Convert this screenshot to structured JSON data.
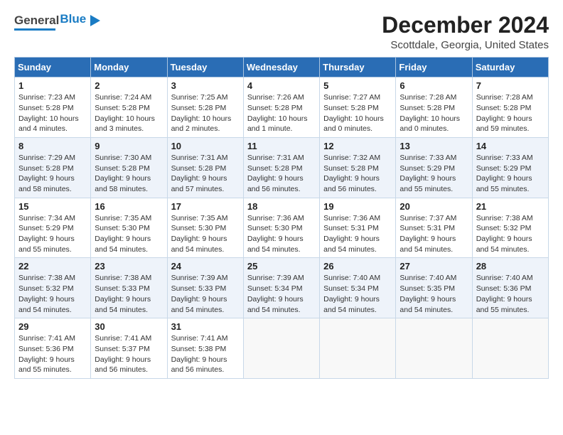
{
  "header": {
    "logo_general": "General",
    "logo_blue": "Blue",
    "month_title": "December 2024",
    "location": "Scottdale, Georgia, United States"
  },
  "weekdays": [
    "Sunday",
    "Monday",
    "Tuesday",
    "Wednesday",
    "Thursday",
    "Friday",
    "Saturday"
  ],
  "weeks": [
    [
      {
        "day": "1",
        "sunrise": "Sunrise: 7:23 AM",
        "sunset": "Sunset: 5:28 PM",
        "daylight": "Daylight: 10 hours and 4 minutes."
      },
      {
        "day": "2",
        "sunrise": "Sunrise: 7:24 AM",
        "sunset": "Sunset: 5:28 PM",
        "daylight": "Daylight: 10 hours and 3 minutes."
      },
      {
        "day": "3",
        "sunrise": "Sunrise: 7:25 AM",
        "sunset": "Sunset: 5:28 PM",
        "daylight": "Daylight: 10 hours and 2 minutes."
      },
      {
        "day": "4",
        "sunrise": "Sunrise: 7:26 AM",
        "sunset": "Sunset: 5:28 PM",
        "daylight": "Daylight: 10 hours and 1 minute."
      },
      {
        "day": "5",
        "sunrise": "Sunrise: 7:27 AM",
        "sunset": "Sunset: 5:28 PM",
        "daylight": "Daylight: 10 hours and 0 minutes."
      },
      {
        "day": "6",
        "sunrise": "Sunrise: 7:28 AM",
        "sunset": "Sunset: 5:28 PM",
        "daylight": "Daylight: 10 hours and 0 minutes."
      },
      {
        "day": "7",
        "sunrise": "Sunrise: 7:28 AM",
        "sunset": "Sunset: 5:28 PM",
        "daylight": "Daylight: 9 hours and 59 minutes."
      }
    ],
    [
      {
        "day": "8",
        "sunrise": "Sunrise: 7:29 AM",
        "sunset": "Sunset: 5:28 PM",
        "daylight": "Daylight: 9 hours and 58 minutes."
      },
      {
        "day": "9",
        "sunrise": "Sunrise: 7:30 AM",
        "sunset": "Sunset: 5:28 PM",
        "daylight": "Daylight: 9 hours and 58 minutes."
      },
      {
        "day": "10",
        "sunrise": "Sunrise: 7:31 AM",
        "sunset": "Sunset: 5:28 PM",
        "daylight": "Daylight: 9 hours and 57 minutes."
      },
      {
        "day": "11",
        "sunrise": "Sunrise: 7:31 AM",
        "sunset": "Sunset: 5:28 PM",
        "daylight": "Daylight: 9 hours and 56 minutes."
      },
      {
        "day": "12",
        "sunrise": "Sunrise: 7:32 AM",
        "sunset": "Sunset: 5:28 PM",
        "daylight": "Daylight: 9 hours and 56 minutes."
      },
      {
        "day": "13",
        "sunrise": "Sunrise: 7:33 AM",
        "sunset": "Sunset: 5:29 PM",
        "daylight": "Daylight: 9 hours and 55 minutes."
      },
      {
        "day": "14",
        "sunrise": "Sunrise: 7:33 AM",
        "sunset": "Sunset: 5:29 PM",
        "daylight": "Daylight: 9 hours and 55 minutes."
      }
    ],
    [
      {
        "day": "15",
        "sunrise": "Sunrise: 7:34 AM",
        "sunset": "Sunset: 5:29 PM",
        "daylight": "Daylight: 9 hours and 55 minutes."
      },
      {
        "day": "16",
        "sunrise": "Sunrise: 7:35 AM",
        "sunset": "Sunset: 5:30 PM",
        "daylight": "Daylight: 9 hours and 54 minutes."
      },
      {
        "day": "17",
        "sunrise": "Sunrise: 7:35 AM",
        "sunset": "Sunset: 5:30 PM",
        "daylight": "Daylight: 9 hours and 54 minutes."
      },
      {
        "day": "18",
        "sunrise": "Sunrise: 7:36 AM",
        "sunset": "Sunset: 5:30 PM",
        "daylight": "Daylight: 9 hours and 54 minutes."
      },
      {
        "day": "19",
        "sunrise": "Sunrise: 7:36 AM",
        "sunset": "Sunset: 5:31 PM",
        "daylight": "Daylight: 9 hours and 54 minutes."
      },
      {
        "day": "20",
        "sunrise": "Sunrise: 7:37 AM",
        "sunset": "Sunset: 5:31 PM",
        "daylight": "Daylight: 9 hours and 54 minutes."
      },
      {
        "day": "21",
        "sunrise": "Sunrise: 7:38 AM",
        "sunset": "Sunset: 5:32 PM",
        "daylight": "Daylight: 9 hours and 54 minutes."
      }
    ],
    [
      {
        "day": "22",
        "sunrise": "Sunrise: 7:38 AM",
        "sunset": "Sunset: 5:32 PM",
        "daylight": "Daylight: 9 hours and 54 minutes."
      },
      {
        "day": "23",
        "sunrise": "Sunrise: 7:38 AM",
        "sunset": "Sunset: 5:33 PM",
        "daylight": "Daylight: 9 hours and 54 minutes."
      },
      {
        "day": "24",
        "sunrise": "Sunrise: 7:39 AM",
        "sunset": "Sunset: 5:33 PM",
        "daylight": "Daylight: 9 hours and 54 minutes."
      },
      {
        "day": "25",
        "sunrise": "Sunrise: 7:39 AM",
        "sunset": "Sunset: 5:34 PM",
        "daylight": "Daylight: 9 hours and 54 minutes."
      },
      {
        "day": "26",
        "sunrise": "Sunrise: 7:40 AM",
        "sunset": "Sunset: 5:34 PM",
        "daylight": "Daylight: 9 hours and 54 minutes."
      },
      {
        "day": "27",
        "sunrise": "Sunrise: 7:40 AM",
        "sunset": "Sunset: 5:35 PM",
        "daylight": "Daylight: 9 hours and 54 minutes."
      },
      {
        "day": "28",
        "sunrise": "Sunrise: 7:40 AM",
        "sunset": "Sunset: 5:36 PM",
        "daylight": "Daylight: 9 hours and 55 minutes."
      }
    ],
    [
      {
        "day": "29",
        "sunrise": "Sunrise: 7:41 AM",
        "sunset": "Sunset: 5:36 PM",
        "daylight": "Daylight: 9 hours and 55 minutes."
      },
      {
        "day": "30",
        "sunrise": "Sunrise: 7:41 AM",
        "sunset": "Sunset: 5:37 PM",
        "daylight": "Daylight: 9 hours and 56 minutes."
      },
      {
        "day": "31",
        "sunrise": "Sunrise: 7:41 AM",
        "sunset": "Sunset: 5:38 PM",
        "daylight": "Daylight: 9 hours and 56 minutes."
      },
      null,
      null,
      null,
      null
    ]
  ]
}
